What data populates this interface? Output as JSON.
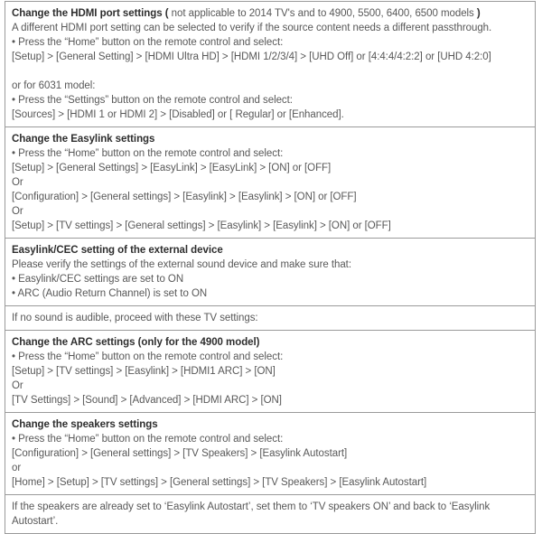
{
  "document": {
    "title": "TV HDMI / Easylink / ARC / Speaker settings instructions",
    "border_color": "#9a9a9a",
    "text_color": "#585858",
    "heading_color": "#2e2e2e",
    "background": "#ffffff"
  },
  "sections": [
    {
      "id": "hdmi-port-settings",
      "heading_bold": "Change the HDMI port settings (",
      "heading_regular": " not applicable to 2014 TV's and to 4900, 5500, 6400, 6500 models ",
      "heading_bold_end": ")",
      "lines": [
        "A different HDMI port setting can be selected to verify if the source content needs a different passthrough.",
        "• Press the “Home” button on the remote control and select:",
        "[Setup] > [General Setting] > [HDMI Ultra HD] > [HDMI 1/2/3/4] > [UHD Off] or [4:4:4/4:2:2] or [UHD 4:2:0]",
        "",
        "or for 6031 model:",
        "• Press the “Settings” button on the remote control and select:",
        "[Sources] > [HDMI 1 or HDMI 2] > [Disabled] or [ Regular] or [Enhanced]."
      ]
    },
    {
      "id": "easylink-settings",
      "heading_bold": "Change the Easylink settings",
      "heading_regular": "",
      "heading_bold_end": "",
      "lines": [
        "• Press the “Home” button on the remote control and select:",
        "[Setup] > [General Settings] > [EasyLink] > [EasyLink] > [ON] or [OFF]",
        "Or",
        "[Configuration] > [General settings] > [Easylink] > [Easylink] > [ON] or [OFF]",
        "Or",
        "[Setup] > [TV settings] > [General settings] > [Easylink] > [Easylink] > [ON] or [OFF]"
      ]
    },
    {
      "id": "easylink-cec-external-device",
      "heading_bold": "Easylink/CEC setting of the external device",
      "heading_regular": "",
      "heading_bold_end": "",
      "lines": [
        "Please verify the settings of the external sound device and make sure that:",
        "• Easylink/CEC settings are set to ON",
        "• ARC (Audio Return Channel) is set to ON"
      ]
    },
    {
      "id": "no-sound-note",
      "heading_bold": "",
      "heading_regular": "",
      "heading_bold_end": "",
      "lines": [
        "If no sound is audible, proceed with these TV settings:"
      ]
    },
    {
      "id": "arc-settings",
      "heading_bold": "Change the ARC settings (only for the 4900 model)",
      "heading_regular": "",
      "heading_bold_end": "",
      "lines": [
        "• Press the “Home” button on the remote control and select:",
        "[Setup] > [TV settings] > [Easylink] > [HDMI1 ARC] > [ON]",
        "Or",
        "[TV Settings] > [Sound] > [Advanced] > [HDMI ARC] > [ON]"
      ]
    },
    {
      "id": "speakers-settings",
      "heading_bold": "Change the speakers settings",
      "heading_regular": "",
      "heading_bold_end": "",
      "lines": [
        "• Press the “Home” button on the remote control and select:",
        "[Configuration] > [General settings] > [TV Speakers] > [Easylink Autostart]",
        "or",
        "[Home] > [Setup] > [TV settings] > [General settings] > [TV Speakers] > [Easylink Autostart]"
      ]
    },
    {
      "id": "speakers-note",
      "heading_bold": "",
      "heading_regular": "",
      "heading_bold_end": "",
      "lines": [
        "If the speakers are already set to ‘Easylink Autostart’, set them to ‘TV speakers ON’ and back to ‘Easylink Autostart’."
      ]
    }
  ]
}
